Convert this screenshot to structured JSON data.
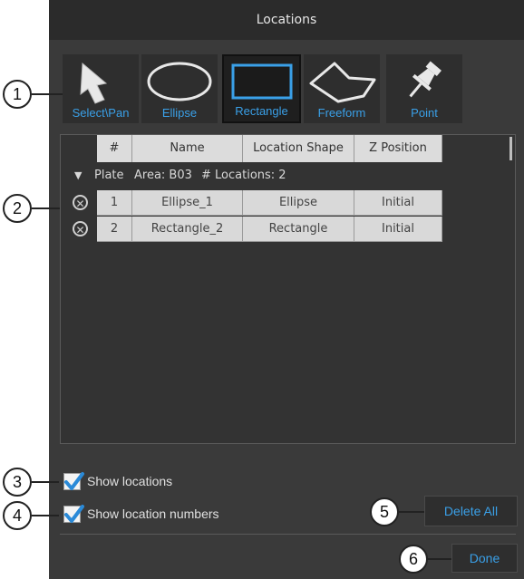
{
  "window": {
    "title": "Locations"
  },
  "callouts": [
    "1",
    "2",
    "3",
    "4",
    "5",
    "6"
  ],
  "toolbar": {
    "tools": [
      {
        "label": "Select\\Pan",
        "icon": "pointer-arrow-icon"
      },
      {
        "label": "Ellipse",
        "icon": "ellipse-icon"
      },
      {
        "label": "Rectangle",
        "icon": "rectangle-icon",
        "selected": true
      },
      {
        "label": "Freeform",
        "icon": "freeform-polygon-icon"
      },
      {
        "label": "Point",
        "icon": "pushpin-icon"
      }
    ]
  },
  "table": {
    "columns": [
      "#",
      "Name",
      "Location Shape",
      "Z Position"
    ],
    "group": {
      "plate_label": "Plate",
      "area_label": "Area: B03",
      "count_label": "# Locations: 2"
    },
    "rows": [
      {
        "num": "1",
        "name": "Ellipse_1",
        "shape": "Ellipse",
        "z": "Initial"
      },
      {
        "num": "2",
        "name": "Rectangle_2",
        "shape": "Rectangle",
        "z": "Initial"
      }
    ]
  },
  "options": {
    "show_locations": {
      "label": "Show locations",
      "checked": true
    },
    "show_numbers": {
      "label": "Show location numbers",
      "checked": true
    }
  },
  "buttons": {
    "delete_all": "Delete All",
    "done": "Done"
  },
  "colors": {
    "accent": "#3aa0e8",
    "panel": "#3a3a3a",
    "titlebar": "#2b2b2b",
    "check": "#2a8ad8"
  }
}
